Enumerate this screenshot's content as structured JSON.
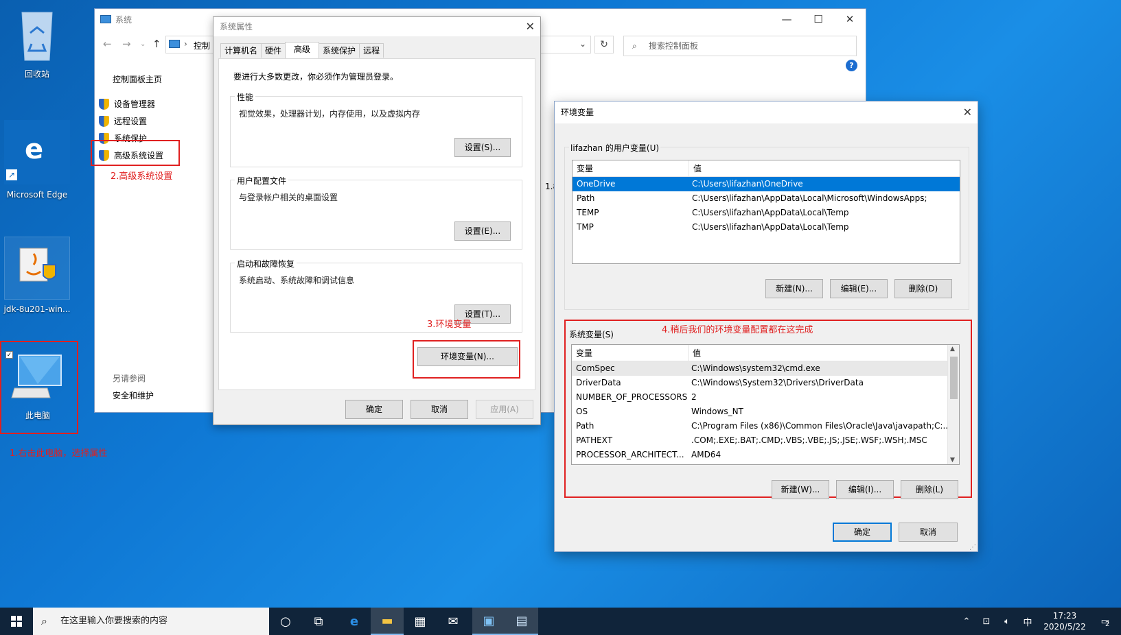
{
  "desktop": {
    "recycle_bin": "回收站",
    "edge": "Microsoft Edge",
    "jdk": "jdk-8u201-win...",
    "this_pc": "此电脑"
  },
  "annotations": {
    "step1": "1.右击此电脑，选择属性",
    "step2": "2.高级系统设置",
    "step3": "3.环境变量",
    "step4": "4.稍后我们的环境变量配置都在这完成"
  },
  "system_window": {
    "title": "系统",
    "address": "控制",
    "search_placeholder": "搜索控制面板",
    "home_link": "控制面板主页",
    "links": [
      "设备管理器",
      "远程设置",
      "系统保护",
      "高级系统设置"
    ],
    "see_also_label": "另请参阅",
    "see_also_link": "安全和维护",
    "partial_text": "1.8"
  },
  "properties_dialog": {
    "title": "系统属性",
    "tabs": [
      "计算机名",
      "硬件",
      "高级",
      "系统保护",
      "远程"
    ],
    "admin_note": "要进行大多数更改，你必须作为管理员登录。",
    "perf_title": "性能",
    "perf_desc": "视觉效果，处理器计划，内存使用，以及虚拟内存",
    "perf_btn": "设置(S)...",
    "profile_title": "用户配置文件",
    "profile_desc": "与登录帐户相关的桌面设置",
    "profile_btn": "设置(E)...",
    "startup_title": "启动和故障恢复",
    "startup_desc": "系统启动、系统故障和调试信息",
    "startup_btn": "设置(T)...",
    "env_btn": "环境变量(N)...",
    "ok": "确定",
    "cancel": "取消",
    "apply": "应用(A)"
  },
  "env_dialog": {
    "title": "环境变量",
    "user_group": "lifazhan 的用户变量(U)",
    "col_var": "变量",
    "col_val": "值",
    "user_vars": [
      {
        "name": "OneDrive",
        "value": "C:\\Users\\lifazhan\\OneDrive"
      },
      {
        "name": "Path",
        "value": "C:\\Users\\lifazhan\\AppData\\Local\\Microsoft\\WindowsApps;"
      },
      {
        "name": "TEMP",
        "value": "C:\\Users\\lifazhan\\AppData\\Local\\Temp"
      },
      {
        "name": "TMP",
        "value": "C:\\Users\\lifazhan\\AppData\\Local\\Temp"
      }
    ],
    "user_new": "新建(N)...",
    "user_edit": "编辑(E)...",
    "user_delete": "删除(D)",
    "sys_group": "系统变量(S)",
    "sys_vars": [
      {
        "name": "ComSpec",
        "value": "C:\\Windows\\system32\\cmd.exe"
      },
      {
        "name": "DriverData",
        "value": "C:\\Windows\\System32\\Drivers\\DriverData"
      },
      {
        "name": "NUMBER_OF_PROCESSORS",
        "value": "2"
      },
      {
        "name": "OS",
        "value": "Windows_NT"
      },
      {
        "name": "Path",
        "value": "C:\\Program Files (x86)\\Common Files\\Oracle\\Java\\javapath;C:..."
      },
      {
        "name": "PATHEXT",
        "value": ".COM;.EXE;.BAT;.CMD;.VBS;.VBE;.JS;.JSE;.WSF;.WSH;.MSC"
      },
      {
        "name": "PROCESSOR_ARCHITECT...",
        "value": "AMD64"
      }
    ],
    "sys_new": "新建(W)...",
    "sys_edit": "编辑(I)...",
    "sys_delete": "删除(L)",
    "ok": "确定",
    "cancel": "取消"
  },
  "taskbar": {
    "search_placeholder": "在这里输入你要搜索的内容",
    "ime": "中",
    "time": "17:23",
    "date": "2020/5/22",
    "notification_count": "2"
  }
}
